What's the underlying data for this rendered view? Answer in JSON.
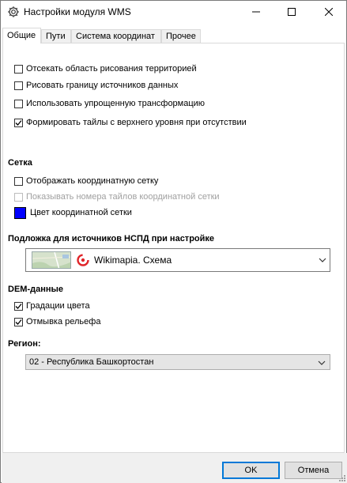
{
  "window": {
    "title": "Настройки модуля WMS",
    "icon": "gear-icon"
  },
  "tabs": [
    {
      "label": "Общие",
      "active": true
    },
    {
      "label": "Пути",
      "active": false
    },
    {
      "label": "Система координат",
      "active": false
    },
    {
      "label": "Прочее",
      "active": false
    }
  ],
  "options": [
    {
      "label": "Отсекать область рисования территорией",
      "checked": false,
      "enabled": true
    },
    {
      "label": "Рисовать границу источников данных",
      "checked": false,
      "enabled": true
    },
    {
      "label": "Использовать упрощенную трансформацию",
      "checked": false,
      "enabled": true
    },
    {
      "label": "Формировать тайлы с верхнего уровня при отсутствии",
      "checked": true,
      "enabled": true
    }
  ],
  "grid": {
    "heading": "Сетка",
    "show_grid": {
      "label": "Отображать координатную сетку",
      "checked": false,
      "enabled": true
    },
    "show_tile_numbers": {
      "label": "Показывать номера тайлов координатной сетки",
      "checked": false,
      "enabled": false
    },
    "color_label": "Цвет координатной сетки",
    "color": "#0000ff"
  },
  "basemap": {
    "heading": "Подложка для источников  НСПД  при настройке",
    "selected": "Wikimapia. Схема",
    "logo_icon": "wikimapia-logo-icon",
    "logo_color": "#e0262b"
  },
  "dem": {
    "heading": "DEM-данные",
    "color_gradations": {
      "label": "Градации цвета",
      "checked": true
    },
    "hillshade": {
      "label": "Отмывка рельефа",
      "checked": true
    }
  },
  "region": {
    "heading": "Регион:",
    "selected": "02 - Республика Башкортостан"
  },
  "footer": {
    "ok_label": "OK",
    "cancel_label": "Отмена"
  },
  "colors": {
    "accent": "#0078d7",
    "footer_bg": "#f0f0f0"
  }
}
